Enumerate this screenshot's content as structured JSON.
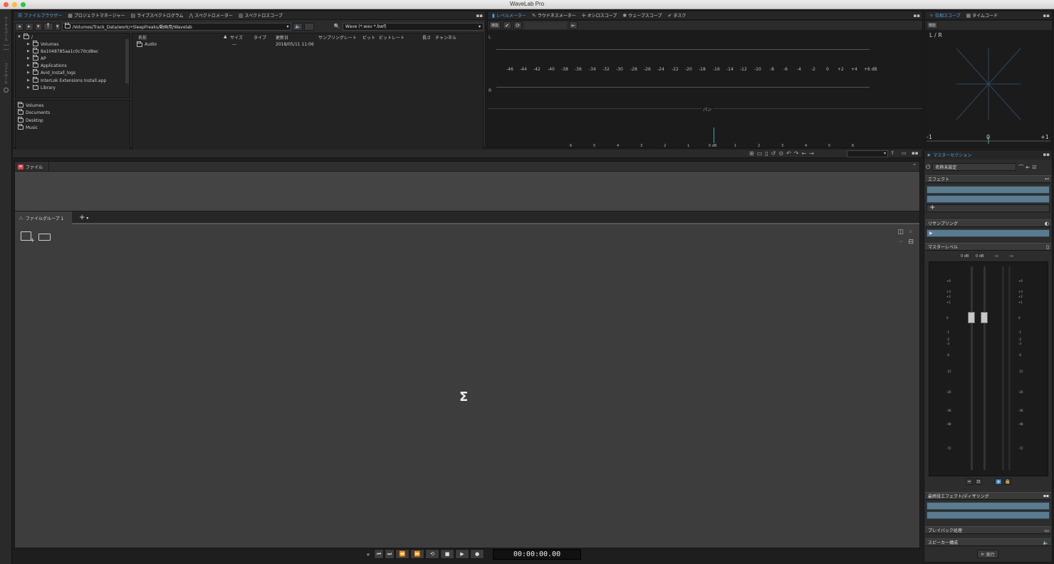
{
  "window": {
    "title": "WaveLab Pro"
  },
  "side_strip": {
    "labels": [
      "ワークスペース",
      "コントロール"
    ]
  },
  "top_left_tabs": [
    {
      "label": "ファイルブラウザー",
      "icon": "list-icon",
      "active": true
    },
    {
      "label": "プロジェクトマネージャー",
      "icon": "grid-icon",
      "active": false
    },
    {
      "label": "ライブスペクトログラム",
      "icon": "spectrogram-icon",
      "active": false
    },
    {
      "label": "スペクトロメーター",
      "icon": "spectrometer-icon",
      "active": false
    },
    {
      "label": "スペクトロスコープ",
      "icon": "spectroscope-icon",
      "active": false
    }
  ],
  "file_browser": {
    "path": "/Volumes/Track_Data/work/•SleepFreaks/動画用/Wavelab",
    "filter": "Wave (*.wav *.bwf)",
    "tree_root": "/",
    "tree_items": [
      "Volumes",
      "8a1048785aa1c0c70cd8ec",
      "AP",
      "Applications",
      "Avid_Install_logs",
      "InterLok Extensions Install.app",
      "Library"
    ],
    "favorites": [
      "Volumes",
      "Documents",
      "Desktop",
      "Music"
    ],
    "columns": [
      "名前",
      "サイズ",
      "タイプ",
      "更新日",
      "サンプリングレート",
      "ビット",
      "ビットレート",
      "長さ",
      "チャンネル"
    ],
    "rows": [
      {
        "name": "Audio",
        "size": "—",
        "modified": "2018/05/11 11:06"
      }
    ]
  },
  "top_mid_tabs": [
    {
      "label": "レベルメーター",
      "icon": "bars-icon",
      "active": true
    },
    {
      "label": "ラウドネスメーター",
      "icon": "pen-icon",
      "active": false
    },
    {
      "label": "オシロスコープ",
      "icon": "crosshair-icon",
      "active": false
    },
    {
      "label": "ウェーブスコープ",
      "icon": "gear-icon",
      "active": false
    },
    {
      "label": "タスク",
      "icon": "check-icon",
      "active": false
    }
  ],
  "level_meter": {
    "function_label": "機能",
    "channel_left": "L",
    "channel_right": "R",
    "db_scale": [
      "-46",
      "-44",
      "-42",
      "-40",
      "-38",
      "-36",
      "-34",
      "-32",
      "-30",
      "-28",
      "-26",
      "-24",
      "-22",
      "-20",
      "-18",
      "-16",
      "-14",
      "-12",
      "-10",
      "-8",
      "-6",
      "-4",
      "-2",
      "0",
      "+2",
      "+4",
      "+6 dB"
    ],
    "pan_label": "パン",
    "pan_scale": [
      "6",
      "5",
      "4",
      "3",
      "2",
      "1",
      "0 dB",
      "1",
      "2",
      "3",
      "4",
      "5",
      "6"
    ]
  },
  "top_right_tabs": [
    {
      "label": "位相スコープ",
      "icon": "phase-icon",
      "active": true
    },
    {
      "label": "タイムコード",
      "icon": "grid-icon",
      "active": false
    }
  ],
  "phase_scope": {
    "function_label": "機能",
    "channel_label": "L / R",
    "scale_left": "-1",
    "scale_mid": "0",
    "scale_right": "+1"
  },
  "file_area": {
    "header_label": "ファイル",
    "group_tab_label": "ファイルグループ 1",
    "add_tab_label": "+",
    "center_icon": "Σ"
  },
  "master_section": {
    "title": "マスターセクション",
    "preset_label": "名称未設定",
    "effects_label": "エフェクト",
    "resampling_label": "リサンプリング",
    "master_level_label": "マスターレベル",
    "level_readouts": [
      "0 dB",
      "0 dB",
      "-∞",
      "-∞"
    ],
    "meter_scale_left": [
      "+6",
      "+3",
      "+2",
      "+1",
      "0",
      "-1",
      "-2",
      "-3",
      "-6",
      "-12",
      "-24",
      "-36",
      "-48",
      "-72"
    ],
    "final_effects_label": "最終段エフェクト/ディザリング",
    "playback_label": "プレイバック処理",
    "speaker_label": "スピーカー構成",
    "render_label": "実行"
  },
  "transport": {
    "buttons": [
      "«",
      "⏮",
      "⏭",
      "⏪",
      "⏩",
      "⟲",
      "■",
      "▶",
      "●"
    ],
    "timecode": "00:00:00.00"
  }
}
